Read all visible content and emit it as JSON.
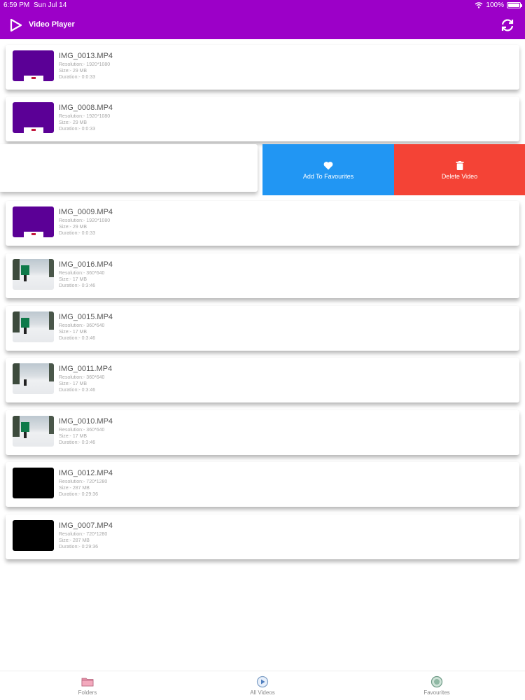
{
  "status_bar": {
    "time": "6:59 PM",
    "date": "Sun Jul 14",
    "battery": "100%"
  },
  "header": {
    "title": "Video Player"
  },
  "colors": {
    "header": "#9c00c8",
    "favourite_action": "#2196f3",
    "delete_action": "#f44336"
  },
  "videos": [
    {
      "name": "IMG_0013.MP4",
      "resolution": "Resolution:- 1920*1080",
      "size": "Size:- 29 MB",
      "duration": "Duration:- 0:0:33",
      "thumb": "purple"
    },
    {
      "name": "IMG_0008.MP4",
      "resolution": "Resolution:- 1920*1080",
      "size": "Size:- 29 MB",
      "duration": "Duration:- 0:0:33",
      "thumb": "purple"
    },
    {
      "name": "IMG_0009.MP4",
      "resolution": "Resolution:- 1920*1080",
      "size": "Size:- 29 MB",
      "duration": "Duration:- 0:0:33",
      "thumb": "purple"
    },
    {
      "name": "IMG_0016.MP4",
      "resolution": "Resolution:- 360*640",
      "size": "Size:- 17 MB",
      "duration": "Duration:- 0:3:46",
      "thumb": "snow"
    },
    {
      "name": "IMG_0015.MP4",
      "resolution": "Resolution:- 360*640",
      "size": "Size:- 17 MB",
      "duration": "Duration:- 0:3:46",
      "thumb": "snow"
    },
    {
      "name": "IMG_0011.MP4",
      "resolution": "Resolution:- 360*640",
      "size": "Size:- 17 MB",
      "duration": "Duration:- 0:3:46",
      "thumb": "snow"
    },
    {
      "name": "IMG_0010.MP4",
      "resolution": "Resolution:- 360*640",
      "size": "Size:- 17 MB",
      "duration": "Duration:- 0:3:46",
      "thumb": "snow"
    },
    {
      "name": "IMG_0012.MP4",
      "resolution": "Resolution:- 720*1280",
      "size": "Size:- 287 MB",
      "duration": "Duration:- 0:29:36",
      "thumb": "black"
    },
    {
      "name": "IMG_0007.MP4",
      "resolution": "Resolution:- 720*1280",
      "size": "Size:- 287 MB",
      "duration": "Duration:- 0:29:36",
      "thumb": "black"
    }
  ],
  "swipe_actions": {
    "favourite_label": "Add To Favourites",
    "delete_label": "Delete Video"
  },
  "tabs": [
    {
      "label": "Folders",
      "icon": "folder-icon"
    },
    {
      "label": "All Videos",
      "icon": "play-circle-icon"
    },
    {
      "label": "Favourites",
      "icon": "favourites-icon"
    }
  ]
}
